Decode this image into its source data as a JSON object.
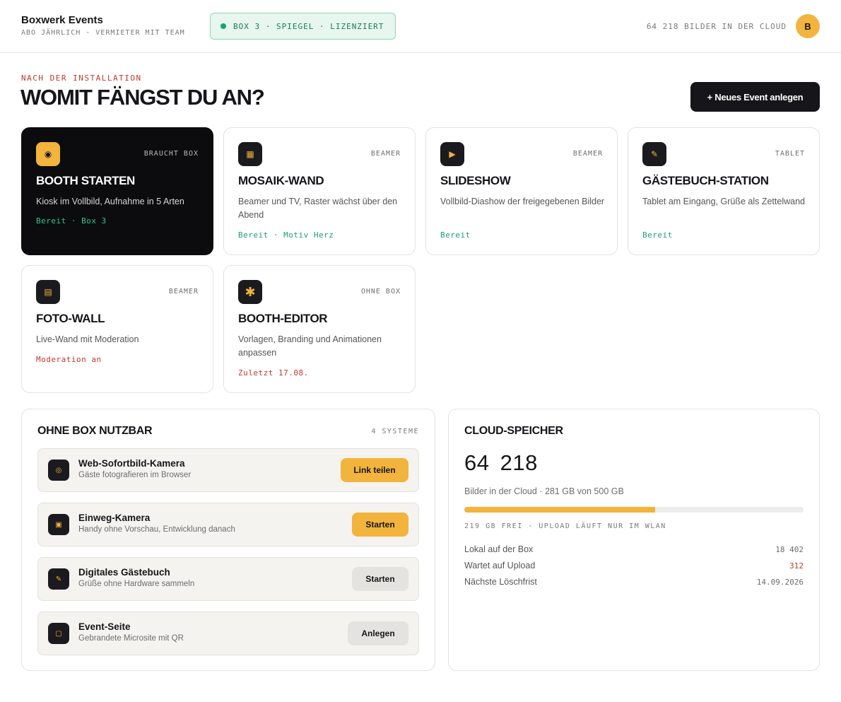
{
  "header": {
    "brand_title": "Boxwerk Events",
    "brand_sub": "ABO JÄHRLICH · VERMIETER MIT TEAM",
    "box_status": "BOX 3 · SPIEGEL · LIZENZIERT",
    "cloud_count": "64 218 BILDER IN DER CLOUD",
    "avatar_initial": "B"
  },
  "intro": {
    "eyebrow": "NACH DER INSTALLATION",
    "title": "WOMIT FÄNGST DU AN?",
    "new_event_button": "+ Neues Event anlegen"
  },
  "cards": [
    {
      "icon": "record-icon",
      "tag": "BRAUCHT BOX",
      "title": "BOOTH STARTEN",
      "desc": "Kiosk im Vollbild, Aufnahme in 5 Arten",
      "status": "Bereit · Box 3"
    },
    {
      "icon": "grid-icon",
      "tag": "BEAMER",
      "title": "MOSAIK-WAND",
      "desc": "Beamer und TV, Raster wächst über den Abend",
      "status": "Bereit · Motiv Herz"
    },
    {
      "icon": "play-icon",
      "tag": "BEAMER",
      "title": "SLIDESHOW",
      "desc": "Vollbild-Diashow der freigegebenen Bilder",
      "status": "Bereit"
    },
    {
      "icon": "pencil-icon",
      "tag": "TABLET",
      "title": "GÄSTEBUCH-STATION",
      "desc": "Tablet am Eingang, Grüße als Zettelwand",
      "status": "Bereit"
    },
    {
      "icon": "wall-icon",
      "tag": "BEAMER",
      "title": "FOTO-WALL",
      "desc": "Live-Wand mit Moderation",
      "status": "Moderation an"
    },
    {
      "icon": "asterisk-icon",
      "tag": "OHNE BOX",
      "title": "BOOTH-EDITOR",
      "desc": "Vorlagen, Branding und Animationen anpassen",
      "status": "Zuletzt 17.08."
    }
  ],
  "systems": {
    "title": "OHNE BOX NUTZBAR",
    "meta": "4 SYSTEME",
    "items": [
      {
        "icon": "camera-icon",
        "name": "Web-Sofortbild-Kamera",
        "desc": "Gäste fotografieren im Browser",
        "button": "Link teilen"
      },
      {
        "icon": "film-icon",
        "name": "Einweg-Kamera",
        "desc": "Handy ohne Vorschau, Entwicklung danach",
        "button": "Starten"
      },
      {
        "icon": "pencil-icon",
        "name": "Digitales Gästebuch",
        "desc": "Grüße ohne Hardware sammeln",
        "button": "Starten"
      },
      {
        "icon": "page-icon",
        "name": "Event-Seite",
        "desc": "Gebrandete Microsite mit QR",
        "button": "Anlegen"
      }
    ]
  },
  "cloud": {
    "title": "CLOUD-SPEICHER",
    "count": "64 218",
    "sub": "Bilder in der Cloud · 281 GB von 500 GB",
    "used_fraction": 0.562,
    "note": "219 GB FREI · UPLOAD LÄUFT NUR IM WLAN",
    "stats": [
      {
        "label": "Lokal auf der Box",
        "value": "18 402"
      },
      {
        "label": "Wartet auf Upload",
        "value": "312"
      },
      {
        "label": "Nächste Löschfrist",
        "value": "14.09.2026"
      }
    ]
  },
  "colors": {
    "accent": "#f2b43c",
    "dark": "#16151a",
    "ok": "#1f9d6c",
    "warn": "#c0392b"
  }
}
